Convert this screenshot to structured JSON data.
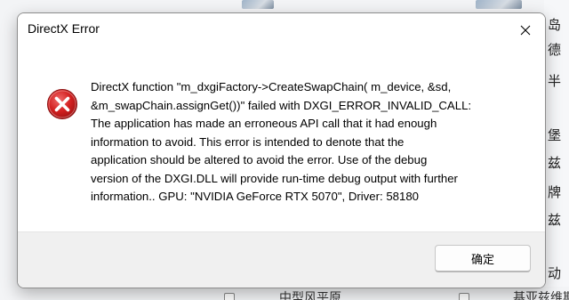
{
  "dialog": {
    "title": "DirectX Error",
    "message": "DirectX function \"m_dxgiFactory->CreateSwapChain( m_device, &sd,\n&m_swapChain.assignGet())\" failed with DXGI_ERROR_INVALID_CALL:\nThe application has made an erroneous API call that it had enough\ninformation to avoid. This error is intended to denote that the\napplication should be altered to avoid the error. Use of the debug\nversion of the DXGI.DLL will provide run-time debug output with further\ninformation.. GPU: \"NVIDIA GeForce RTX 5070\", Driver: 58180",
    "ok_label": "确定",
    "icon": "error-icon",
    "close_icon": "close-icon"
  },
  "background": {
    "right_column": [
      "岛",
      "德",
      "半",
      "堡",
      "兹",
      "牌",
      "兹",
      "动"
    ],
    "bottom_left": "中型风平原",
    "bottom_right": "基亚兹维斯"
  },
  "colors": {
    "error_red": "#d32020",
    "footer_bg": "#f0f0f0",
    "dialog_bg": "#ffffff"
  }
}
